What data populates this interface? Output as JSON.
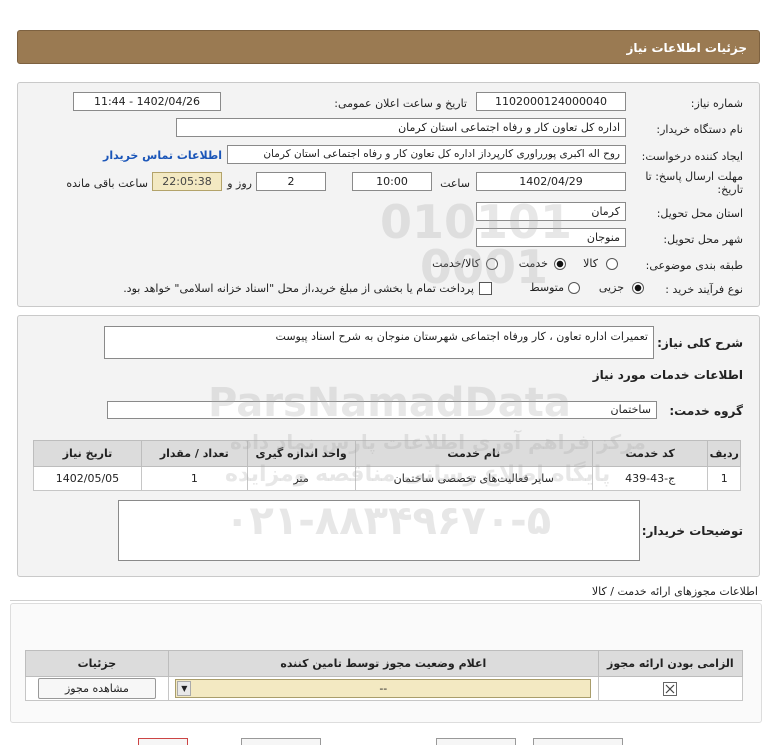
{
  "header": {
    "title": "جزئیات اطلاعات نیاز"
  },
  "fields": {
    "need_number_label": "شماره نیاز:",
    "need_number": "1102000124000040",
    "announce_label": "تاریخ و ساعت اعلان عمومی:",
    "announce_value": "1402/04/26 - 11:44",
    "buyer_org_label": "نام دستگاه خریدار:",
    "buyer_org": "اداره کل تعاون  کار و رفاه اجتماعی استان کرمان",
    "creator_label": "ایجاد کننده درخواست:",
    "creator": "روح اله اکبری پورراوری کارپرداز  اداره کل تعاون  کار و رفاه اجتماعی استان کرمان",
    "contact_link": "اطلاعات تماس خریدار",
    "deadline_label_1": "مهلت ارسال پاسخ: تا",
    "deadline_label_2": "تاریخ:",
    "deadline_date": "1402/04/29",
    "time_label": "ساعت",
    "deadline_time": "10:00",
    "days_value": "2",
    "days_label": "روز و",
    "remaining_time": "22:05:38",
    "remaining_label": "ساعت باقی مانده",
    "province_label": "استان محل تحویل:",
    "province": "کرمان",
    "city_label": "شهر محل تحویل:",
    "city": "منوجان",
    "category_label": "طبقه بندی موضوعی:",
    "category_options": [
      "کالا",
      "خدمت",
      "کالا/خدمت"
    ],
    "category_selected": "خدمت",
    "process_label": "نوع فرآیند خرید :",
    "process_options": [
      "جزیی",
      "متوسط"
    ],
    "process_selected": "جزیی",
    "payment_note": "پرداخت تمام یا بخشی از مبلغ خرید،از محل \"اسناد خزانه اسلامی\" خواهد بود."
  },
  "description": {
    "label": "شرح کلی نیاز:",
    "value": "تعمیرات اداره تعاون ، کار ورفاه اجتماعی شهرستان منوجان به شرح اسناد پیوست"
  },
  "services": {
    "section_title": "اطلاعات خدمات مورد نیاز",
    "group_label": "گروه خدمت:",
    "group_value": "ساختمان",
    "columns": [
      "ردیف",
      "کد خدمت",
      "نام خدمت",
      "واحد اندازه گیری",
      "تعداد / مقدار",
      "تاریخ نیاز"
    ],
    "rows": [
      [
        "1",
        "ج-43-439",
        "سایر فعالیت‌های تخصصی ساختمان",
        "متر",
        "1",
        "1402/05/05"
      ]
    ]
  },
  "buyer_notes": {
    "label": "توضیحات خریدار:",
    "value": ""
  },
  "permits": {
    "section_title": "اطلاعات مجوزهای ارائه خدمت / کالا",
    "columns": [
      "الزامی بودن ارائه مجوز",
      "اعلام وضعیت مجوز توسط تامین کننده",
      "جزئیات"
    ],
    "select_value": "--",
    "view_button": "مشاهده مجوز"
  },
  "watermark": {
    "digits_1": "010101",
    "digits_2": "0001",
    "brand": "ParsNamadData",
    "line_1": "مرکز فراهم آوری اطلاعات پارس نماد داده",
    "line_2": "پایگاه اطلاع رسانی مناقصه ومزایده",
    "phone": "۰۲۱-۸۸۳۴۹۶۷۰-۵"
  }
}
